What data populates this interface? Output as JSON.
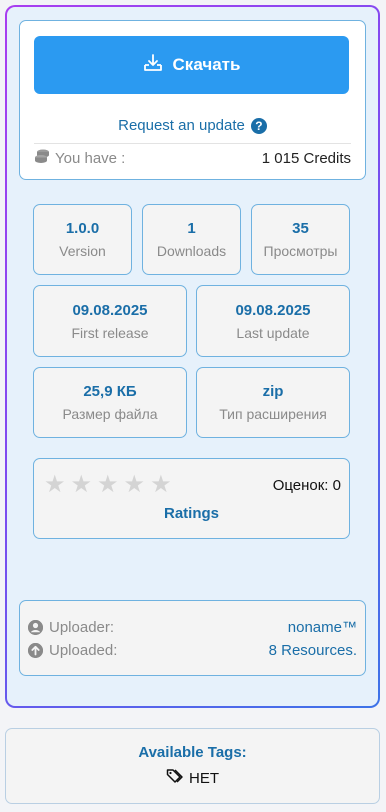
{
  "download": {
    "button_label": "Скачать",
    "request_update": "Request an update",
    "credits_label": "You have :",
    "credits_value": "1 015 Credits"
  },
  "stats": [
    {
      "value": "1.0.0",
      "label": "Version"
    },
    {
      "value": "1",
      "label": "Downloads"
    },
    {
      "value": "35",
      "label": "Просмотры"
    },
    {
      "value": "09.08.2025",
      "label": "First release"
    },
    {
      "value": "09.08.2025",
      "label": "Last update"
    },
    {
      "value": "25,9 КБ",
      "label": "Размер файла"
    },
    {
      "value": "zip",
      "label": "Тип расширения"
    }
  ],
  "ratings": {
    "stars_filled": 0,
    "stars_total": 5,
    "count_label": "Оценок: 0",
    "label": "Ratings"
  },
  "uploader": {
    "uploader_label": "Uploader:",
    "uploader_value": "noname™",
    "uploaded_label": "Uploaded:",
    "uploaded_value": "8 Resources."
  },
  "tags": {
    "title": "Available Tags:",
    "value": "НЕТ"
  },
  "colors": {
    "accent": "#2b9af1",
    "link": "#1a6ea8",
    "gradient_start": "#a93ef0",
    "gradient_end": "#3d73e8"
  },
  "icons": {
    "download": "download-tray-icon",
    "question": "question-circle-icon",
    "coins": "coins-icon",
    "star": "star-icon",
    "user": "user-circle-icon",
    "upload": "upload-circle-icon",
    "tag": "tags-icon"
  }
}
